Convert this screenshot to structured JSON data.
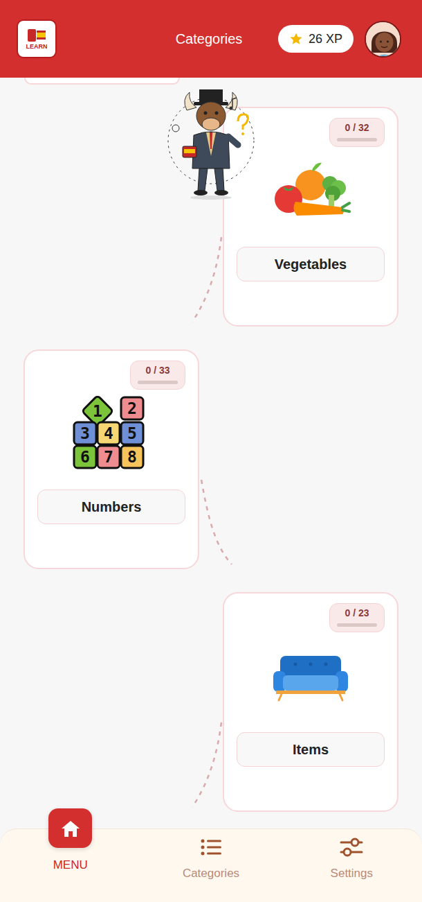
{
  "header": {
    "logo_text": "LEARN",
    "title": "Categories",
    "xp": "26 XP"
  },
  "categories": [
    {
      "name": "Vegetables",
      "progress": "0 / 32",
      "level": 0
    },
    {
      "name": "Numbers",
      "progress": "0 / 33",
      "level": 0,
      "icon_digits": [
        "1",
        "2",
        "3",
        "4",
        "5",
        "6",
        "7",
        "8"
      ]
    },
    {
      "name": "Items",
      "progress": "0 / 23",
      "level": 0
    }
  ],
  "nav": [
    {
      "label": "MENU",
      "selected": true
    },
    {
      "label": "Categories",
      "selected": false
    },
    {
      "label": "Settings",
      "selected": false
    }
  ]
}
